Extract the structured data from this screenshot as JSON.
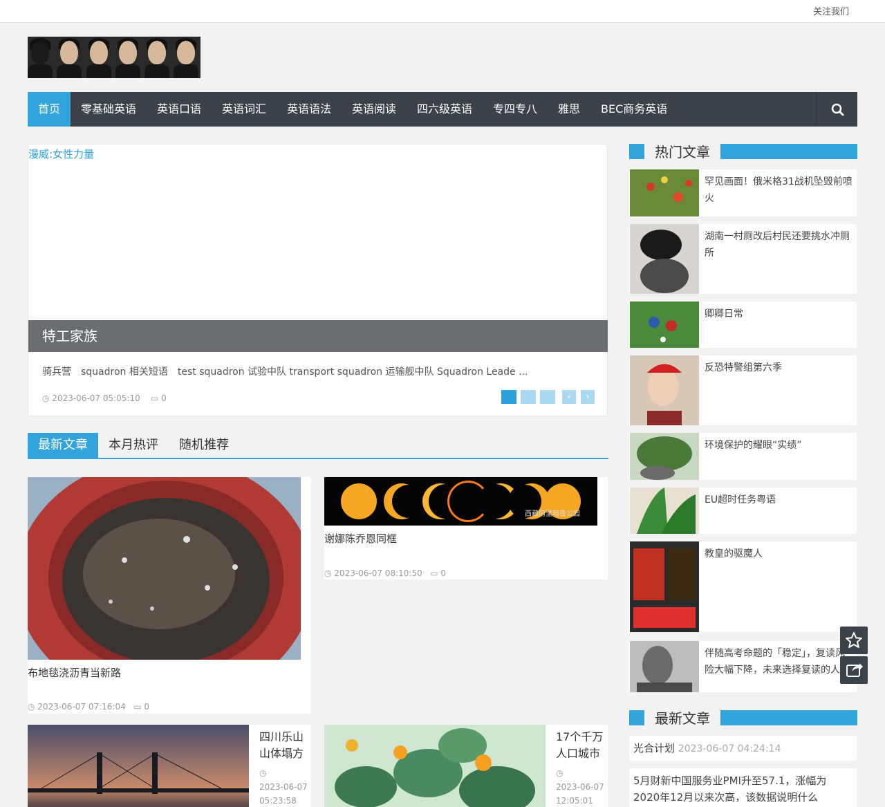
{
  "topbar": {
    "follow": "关注我们"
  },
  "nav": {
    "items": [
      "首页",
      "零基础英语",
      "英语口语",
      "英语词汇",
      "英语语法",
      "英语阅读",
      "四六级英语",
      "专四专八",
      "雅思",
      "BEC商务英语"
    ],
    "search_icon": "search-icon"
  },
  "slider": {
    "image_title": "漫威:女性力量",
    "caption": "特工家族",
    "excerpt": "骑兵营　squadron 相关短语　test squadron 试验中队 transport squadron 运输舰中队 Squadron Leade ...",
    "date": "2023-06-07 05:05:10",
    "comments": "0",
    "prev": "‹",
    "next": "›"
  },
  "tabs": [
    "最新文章",
    "本月热评",
    "随机推荐"
  ],
  "posts": [
    {
      "title": "布地毯浇沥青当新路",
      "date": "2023-06-07 07:16:04",
      "comments": "0"
    },
    {
      "title": "谢娜陈乔恩同框",
      "date": "2023-06-07 08:10:50",
      "comments": "0",
      "watermark": "西藏阿里暗夜公园"
    },
    {
      "title": "四川乐山山体塌方",
      "date": "2023-06-07 05:23:58"
    },
    {
      "title": "17个千万人口城市",
      "date": "2023-06-07 12:05:01"
    }
  ],
  "sidebar": {
    "hot_title": "热门文章",
    "hot": [
      "罕见画面！俄米格31战机坠毁前喷火",
      "湖南一村厕改后村民还要挑水冲厕所",
      "卿卿日常",
      "反恐特警组第六季",
      "环境保护的耀眼“实绩”",
      "EU超时任务粤语",
      "教皇的驱魔人",
      "伴随高考命题的「稳定」，复读风险大幅下降，未来选择复读的人"
    ],
    "latest_title": "最新文章",
    "latest": [
      {
        "title": "光合计划",
        "date": "2023-06-07 04:24:14"
      },
      {
        "title": "5月财新中国服务业PMI升至57.1，涨幅为2020年12月以来次高，该数据说明什么"
      }
    ]
  },
  "float": {
    "star_icon": "star-icon",
    "share_icon": "share-icon"
  },
  "colors": {
    "accent": "#33a4db",
    "nav_bg": "#3b4249"
  }
}
